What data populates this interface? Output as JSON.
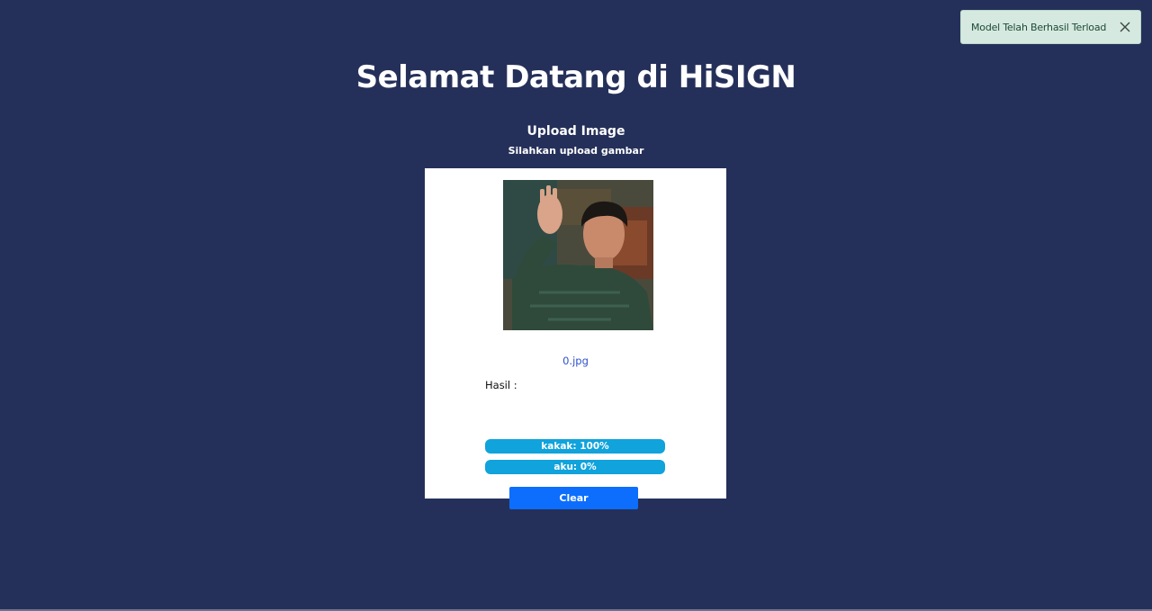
{
  "toast": {
    "message": "Model Telah Berhasil Terload",
    "close_icon": "close-icon"
  },
  "header": {
    "title": "Selamat Datang di HiSIGN"
  },
  "upload": {
    "title": "Upload Image",
    "subtitle": "Silahkan upload gambar",
    "filename": "0.jpg",
    "result_label": "Hasil :",
    "image_subject": "person-raising-hand-photo"
  },
  "predictions": [
    {
      "label": "kakak: 100%",
      "value": 1.0
    },
    {
      "label": "aku: 0%",
      "value": 0.0
    }
  ],
  "actions": {
    "clear_label": "Clear"
  },
  "colors": {
    "background": "#25305a",
    "bar": "#10a3dc",
    "button": "#0d6efd",
    "toast_bg": "#d6e9e1",
    "filename": "#2f52c9"
  }
}
